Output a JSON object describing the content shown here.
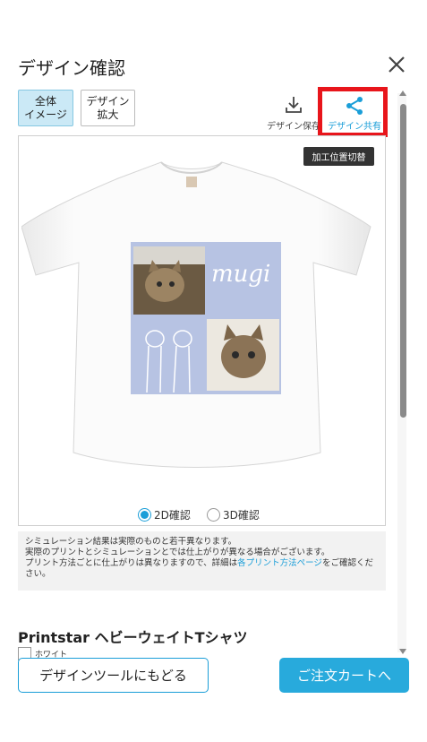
{
  "header": {
    "title": "デザイン確認"
  },
  "view_tabs": {
    "whole_line1": "全体",
    "whole_line2": "イメージ",
    "zoom_line1": "デザイン",
    "zoom_line2": "拡大"
  },
  "tools": {
    "save_label": "デザイン保存",
    "share_label": "デザイン共有"
  },
  "preview": {
    "position_toggle": "加工位置切替",
    "design_text": "mugi",
    "modes": [
      "2D確認",
      "3D確認"
    ],
    "selected_mode": "2D確認"
  },
  "notice": {
    "line1": "シミュレーション結果は実際のものと若干異なります。",
    "line2": "実際のプリントとシミュレーションとでは仕上がりが異なる場合がございます。",
    "line3_pre": "プリント方法ごとに仕上がりは異なりますので、詳細は",
    "line3_link": "各プリント方法ページ",
    "line3_post": "をご確認ください。"
  },
  "product": {
    "name": "Printstar ヘビーウェイトTシャツ",
    "color": "ホワイト"
  },
  "footer": {
    "back_label": "デザインツールにもどる",
    "cart_label": "ご注文カートへ"
  },
  "colors": {
    "accent": "#1a9ed8",
    "cart_button": "#28aadc",
    "highlight": "#e8151b",
    "design_bg": "#b7c3e3"
  }
}
